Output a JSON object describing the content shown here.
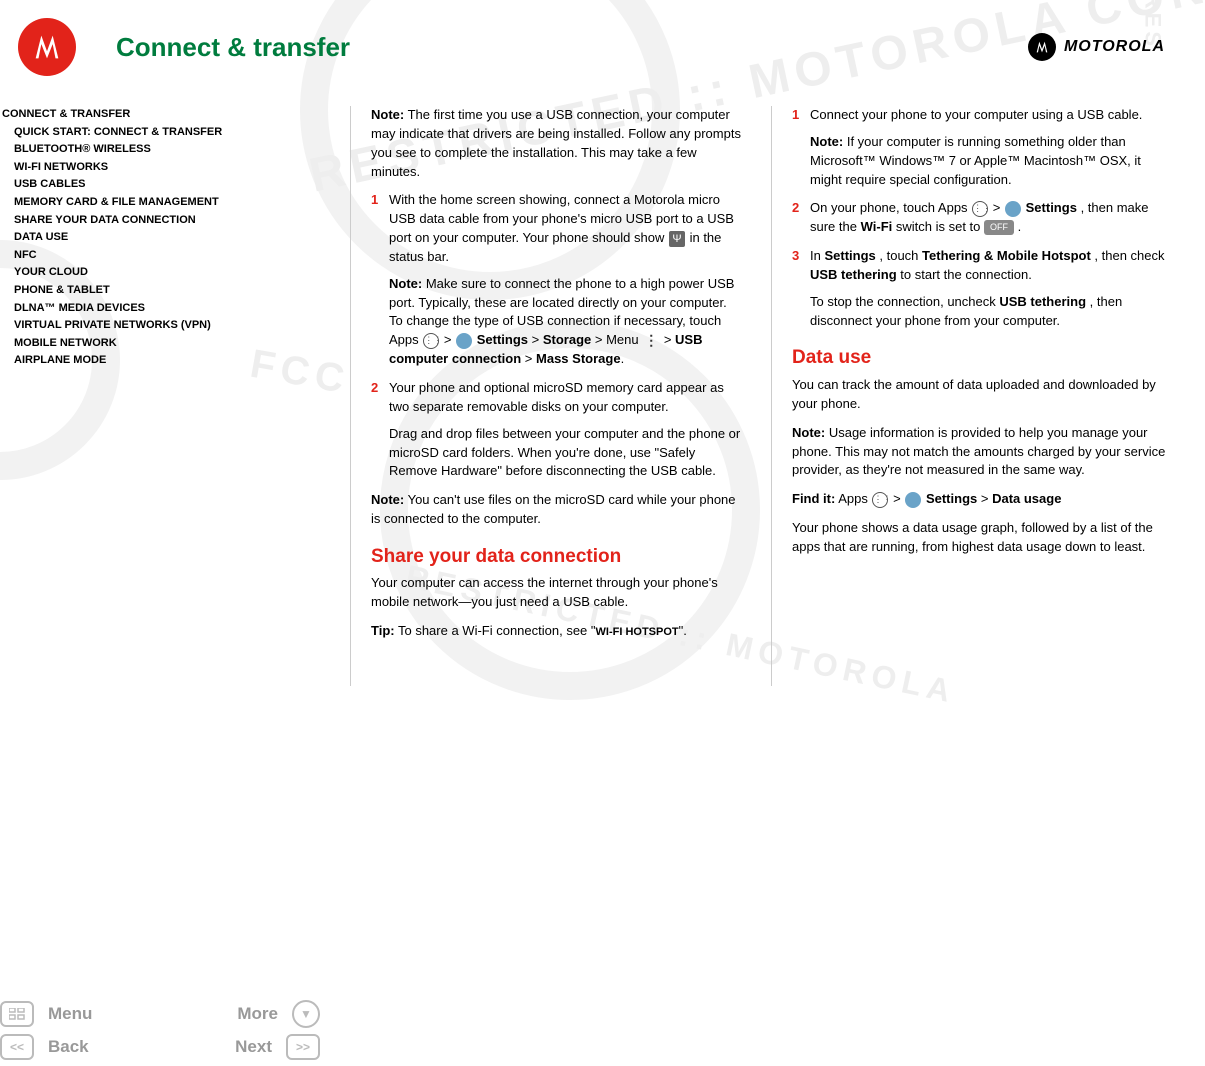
{
  "header": {
    "title": "Connect & transfer",
    "brand": "MOTOROLA"
  },
  "toc": {
    "top": "Connect & transfer",
    "items": [
      "Quick start: Connect & transfer",
      "Bluetooth® wireless",
      "Wi-Fi networks",
      "USB cables",
      "Memory card & file management",
      "Share your data connection",
      "Data use",
      "NFC",
      "Your cloud",
      "Phone & tablet",
      "DLNA™ media devices",
      "Virtual Private Networks (VPN)",
      "Mobile network",
      "Airplane mode"
    ]
  },
  "nav": {
    "menu": "Menu",
    "more": "More",
    "back": "Back",
    "next": "Next",
    "back_icon": "<<",
    "next_icon": ">>"
  },
  "col1": {
    "note1_label": "Note:",
    "note1": " The first time you use a USB connection, your computer may indicate that drivers are being installed. Follow any prompts you see to complete the installation. This may take a few minutes.",
    "step1a": "With the home screen showing, connect a Motorola micro USB data cable from your phone's micro USB port to a USB port on your computer. Your phone should show ",
    "step1b": " in the status bar.",
    "step1_note_label": "Note:",
    "step1_note_a": " Make sure to connect the phone to a high power USB port. Typically, these are located directly on your computer. To change the type of USB connection if necessary, touch Apps ",
    "step1_note_b": " > ",
    "settings": "Settings",
    "storage": "Storage",
    "menu_label": " > Menu ",
    "usb_conn": "USB computer connection",
    "mass_storage": "Mass Storage",
    "step2a": "Your phone and optional microSD memory card appear as two separate removable disks on your computer.",
    "step2b": "Drag and drop files between your computer and the phone or microSD card folders. When you're done, use \"Safely Remove Hardware\" before disconnecting the USB cable.",
    "note2_label": "Note:",
    "note2": " You can't use files on the microSD card while your phone is connected to the computer.",
    "h2_share": "Share your data connection",
    "share_intro": "Your computer can access the internet through your phone's mobile network—you just need a USB cable.",
    "tip_label": "Tip:",
    "tip": " To share a Wi-Fi connection, see \"",
    "wifi_hotspot": "Wi-Fi hotspot",
    "tip_end": "\"."
  },
  "col2": {
    "s1": "Connect your phone to your computer using a USB cable.",
    "s1_note_label": "Note:",
    "s1_note": " If your computer is running something older than Microsoft™ Windows™ 7 or Apple™ Macintosh™ OSX, it might require special configuration.",
    "s2a": "On your phone, touch Apps ",
    "s2b": " > ",
    "settings": "Settings",
    "s2c": ", then make sure the ",
    "wifi": "Wi-Fi",
    "s2d": " switch is set to ",
    "off": "OFF",
    "s2e": " .",
    "s3a": "In ",
    "s3b": ", touch ",
    "tethering": "Tethering & Mobile Hotspot",
    "s3c": ", then check ",
    "usb_tether": "USB tethering",
    "s3d": " to start the connection.",
    "s3e": "To stop the connection, uncheck ",
    "s3f": ", then disconnect your phone from your computer.",
    "h2_data": "Data use",
    "data_intro": "You can track the amount of data uploaded and downloaded by your phone.",
    "data_note_label": "Note:",
    "data_note": " Usage information is provided to help you manage your phone. This may not match the amounts charged by your service provider, as they're not measured in the same way.",
    "findit_label": "Find it:",
    "findit_a": " Apps ",
    "findit_b": " > ",
    "data_usage": "Data usage",
    "data_outro": "Your phone shows a data usage graph, followed by a list of the apps that are running, from highest data usage down to least."
  }
}
